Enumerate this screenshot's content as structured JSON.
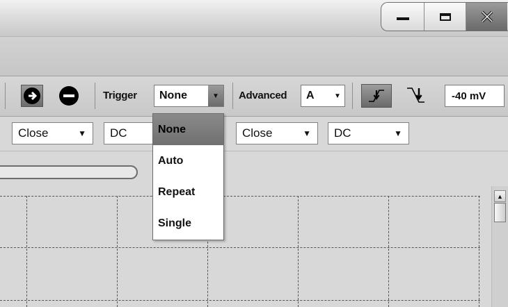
{
  "toolbar": {
    "trigger_label": "Trigger",
    "trigger_value": "None",
    "advanced_label": "Advanced",
    "advanced_value": "A",
    "threshold_value": "-40 mV"
  },
  "channels": [
    {
      "coupling": "Close",
      "mode": "DC"
    },
    {
      "coupling": "Close",
      "mode": "DC"
    }
  ],
  "trigger_dropdown": {
    "options": [
      "None",
      "Auto",
      "Repeat",
      "Single"
    ],
    "selected": "None"
  },
  "icons": [
    "minimize-icon",
    "maximize-icon",
    "close-icon",
    "add-channel-icon",
    "remove-channel-icon",
    "rising-edge-icon",
    "falling-edge-icon",
    "scroll-up-icon"
  ]
}
